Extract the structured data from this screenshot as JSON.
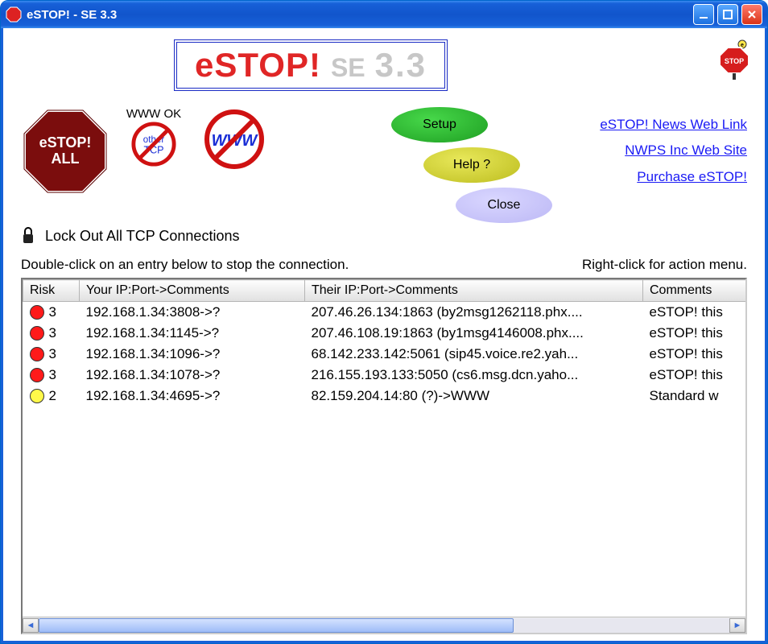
{
  "window": {
    "title": "eSTOP! - SE 3.3"
  },
  "logo": {
    "main": "eSTOP!",
    "se": "SE",
    "version": "3.3"
  },
  "buttons": {
    "estop_all_line1": "eSTOP!",
    "estop_all_line2": "ALL",
    "www_ok": "WWW OK",
    "other_tcp": "other\nTCP",
    "www_no": "WWW",
    "setup": "Setup",
    "help": "Help ?",
    "close": "Close"
  },
  "links": {
    "news": "eSTOP! News Web Link",
    "nwps": "NWPS Inc Web Site",
    "purchase": "Purchase eSTOP!"
  },
  "lock_label": "Lock Out All TCP Connections",
  "hints": {
    "left": "Double-click on an entry below to stop the connection.",
    "right": "Right-click for action menu."
  },
  "table": {
    "headers": {
      "risk": "Risk",
      "your": "Your IP:Port->Comments",
      "their": "Their IP:Port->Comments",
      "comments": "Comments"
    },
    "rows": [
      {
        "risk_color": "red",
        "risk": "3",
        "your": "192.168.1.34:3808->?",
        "their": "207.46.26.134:1863 (by2msg1262118.phx....",
        "comments": "eSTOP! this"
      },
      {
        "risk_color": "red",
        "risk": "3",
        "your": "192.168.1.34:1145->?",
        "their": "207.46.108.19:1863 (by1msg4146008.phx....",
        "comments": "eSTOP! this"
      },
      {
        "risk_color": "red",
        "risk": "3",
        "your": "192.168.1.34:1096->?",
        "their": "68.142.233.142:5061 (sip45.voice.re2.yah...",
        "comments": "eSTOP! this"
      },
      {
        "risk_color": "red",
        "risk": "3",
        "your": "192.168.1.34:1078->?",
        "their": "216.155.193.133:5050 (cs6.msg.dcn.yaho...",
        "comments": "eSTOP! this"
      },
      {
        "risk_color": "yellow",
        "risk": "2",
        "your": "192.168.1.34:4695->?",
        "their": "82.159.204.14:80 (?)->WWW",
        "comments": "Standard w"
      }
    ]
  }
}
